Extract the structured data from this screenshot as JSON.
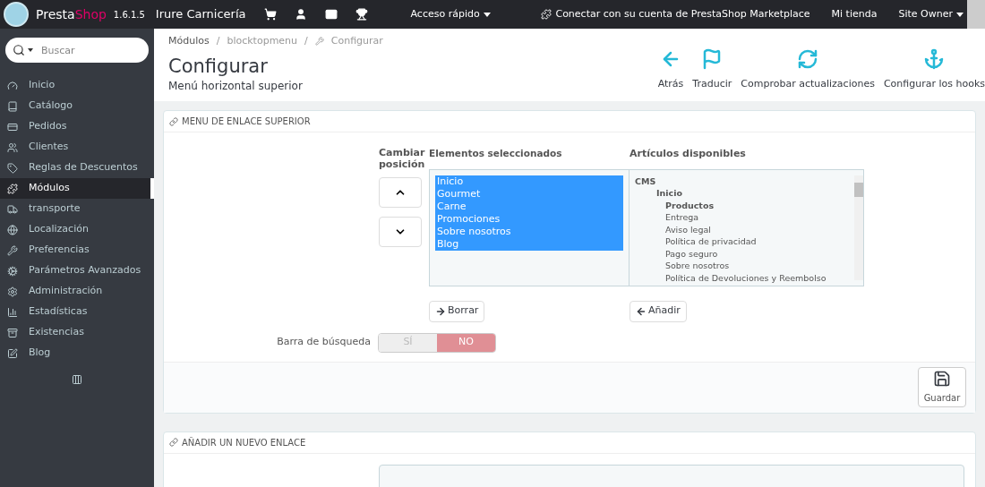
{
  "header": {
    "brand": "Presta",
    "brand_accent": "Shop",
    "version": "1.6.1.5",
    "shop_name": "Irure Carnicería",
    "quick_access": "Acceso rápido",
    "marketplace": "Conectar con su cuenta de PrestaShop Marketplace",
    "my_shop": "Mi tienda",
    "user": "Site Owner"
  },
  "sidebar": {
    "search": {
      "placeholder": "Buscar"
    },
    "items": [
      {
        "label": "Inicio",
        "selected": false
      },
      {
        "label": "Catálogo",
        "selected": false
      },
      {
        "label": "Pedidos",
        "selected": false
      },
      {
        "label": "Clientes",
        "selected": false
      },
      {
        "label": "Reglas de Descuentos",
        "selected": false
      },
      {
        "label": "Módulos",
        "selected": true
      },
      {
        "label": "transporte",
        "selected": false
      },
      {
        "label": "Localización",
        "selected": false
      },
      {
        "label": "Preferencias",
        "selected": false
      },
      {
        "label": "Parámetros Avanzados",
        "selected": false
      },
      {
        "label": "Administración",
        "selected": false
      },
      {
        "label": "Estadísticas",
        "selected": false
      },
      {
        "label": "Existencias",
        "selected": false
      },
      {
        "label": "Blog",
        "selected": false
      }
    ]
  },
  "breadcrumb": [
    "Módulos",
    "blocktopmenu",
    "Configurar"
  ],
  "breadcrumb_separator": "/",
  "page": {
    "title": "Configurar",
    "subtitle": "Menú horizontal superior"
  },
  "toolbar": [
    "Atrás",
    "Traducir",
    "Comprobar actualizaciones",
    "Configurar los hooks"
  ],
  "panel": {
    "title": "MENU DE ENLACE SUPERIOR",
    "position_label": "Cambiar posición",
    "selected_label": "Elementos seleccionados",
    "available_label": "Artículos disponibles",
    "selected_items": [
      {
        "label": "Inicio",
        "selected": true
      },
      {
        "label": "Gourmet",
        "selected": true
      },
      {
        "label": "Carne",
        "selected": true
      },
      {
        "label": "Promociones",
        "selected": true
      },
      {
        "label": "Sobre nosotros",
        "selected": true
      },
      {
        "label": "Blog",
        "selected": true
      }
    ],
    "available_items": [
      {
        "label": "CMS",
        "kind": "group",
        "selected": false,
        "children": [
          {
            "label": "Inicio",
            "kind": "category",
            "selected": false,
            "children": [
              {
                "label": "Productos",
                "kind": "category",
                "selected": false
              },
              {
                "label": "Entrega",
                "kind": "page",
                "selected": false
              },
              {
                "label": "Aviso legal",
                "kind": "page",
                "selected": false
              },
              {
                "label": "Política de privacidad",
                "kind": "page",
                "selected": false
              },
              {
                "label": "Pago seguro",
                "kind": "page",
                "selected": false
              },
              {
                "label": "Sobre nosotros",
                "kind": "page",
                "selected": false
              },
              {
                "label": "Política de Devoluciones y Reembolso",
                "kind": "page",
                "selected": false
              }
            ]
          }
        ]
      }
    ],
    "remove_button": "Borrar",
    "add_button": "Añadir",
    "search_bar": {
      "label": "Barra de búsqueda",
      "options": [
        {
          "label": "SÍ",
          "selected": false
        },
        {
          "label": "NO",
          "selected": true
        }
      ]
    },
    "save_button": "Guardar"
  },
  "panel_2": {
    "title": "AÑADIR UN NUEVO ENLACE"
  }
}
